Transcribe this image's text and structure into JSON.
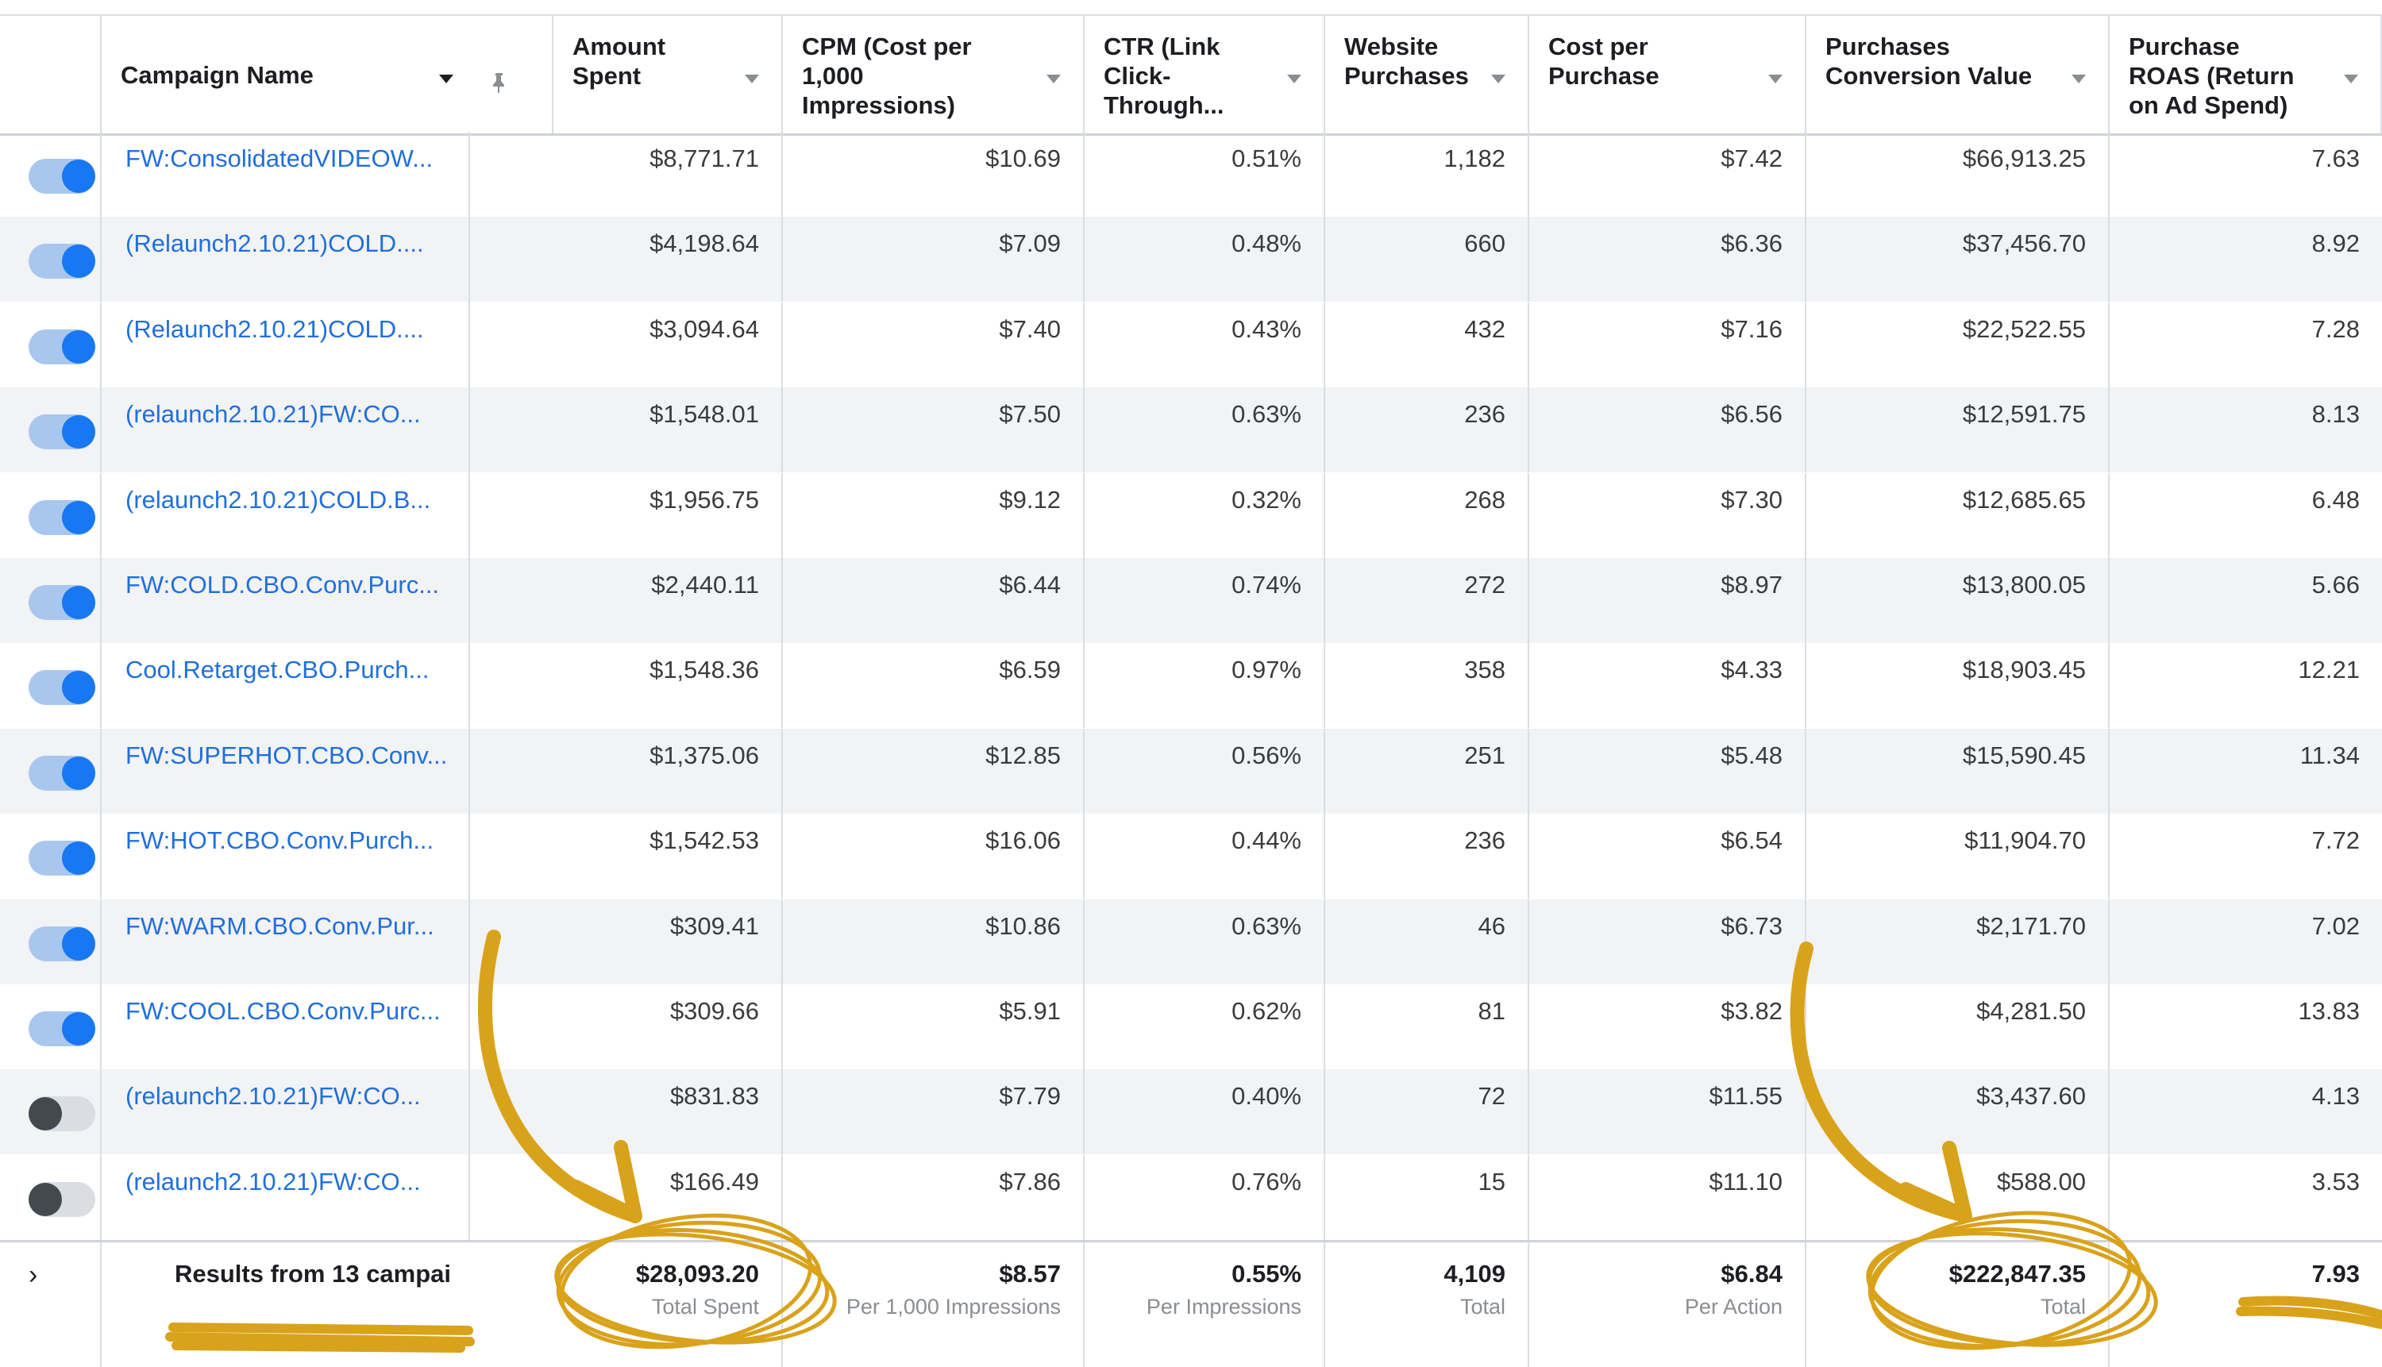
{
  "colors": {
    "accent": "#1877f2",
    "link": "#216fdb",
    "annotation": "#d9a21b"
  },
  "headers": [
    {
      "key": "toggle",
      "label": ""
    },
    {
      "key": "campaign_name",
      "label": "Campaign Name"
    },
    {
      "key": "amount_spent",
      "label": "Amount\nSpent"
    },
    {
      "key": "cpm",
      "label": "CPM (Cost per\n1,000\nImpressions)"
    },
    {
      "key": "ctr",
      "label": "CTR (Link\nClick-\nThrough..."
    },
    {
      "key": "website_purchases",
      "label": "Website\nPurchases"
    },
    {
      "key": "cost_per_purchase",
      "label": "Cost per\nPurchase"
    },
    {
      "key": "conversion_value",
      "label": "Purchases\nConversion Value"
    },
    {
      "key": "roas",
      "label": "Purchase\nROAS (Return\non Ad Spend)"
    }
  ],
  "rows": [
    {
      "on": true,
      "name": "FW:ConsolidatedVIDEOW...",
      "spent": "$8,771.71",
      "cpm": "$10.69",
      "ctr": "0.51%",
      "purchases": "1,182",
      "cpp": "$7.42",
      "value": "$66,913.25",
      "roas": "7.63"
    },
    {
      "on": true,
      "name": "(Relaunch2.10.21)COLD....",
      "spent": "$4,198.64",
      "cpm": "$7.09",
      "ctr": "0.48%",
      "purchases": "660",
      "cpp": "$6.36",
      "value": "$37,456.70",
      "roas": "8.92"
    },
    {
      "on": true,
      "name": "(Relaunch2.10.21)COLD....",
      "spent": "$3,094.64",
      "cpm": "$7.40",
      "ctr": "0.43%",
      "purchases": "432",
      "cpp": "$7.16",
      "value": "$22,522.55",
      "roas": "7.28"
    },
    {
      "on": true,
      "name": "(relaunch2.10.21)FW:CO...",
      "spent": "$1,548.01",
      "cpm": "$7.50",
      "ctr": "0.63%",
      "purchases": "236",
      "cpp": "$6.56",
      "value": "$12,591.75",
      "roas": "8.13"
    },
    {
      "on": true,
      "name": "(relaunch2.10.21)COLD.B...",
      "spent": "$1,956.75",
      "cpm": "$9.12",
      "ctr": "0.32%",
      "purchases": "268",
      "cpp": "$7.30",
      "value": "$12,685.65",
      "roas": "6.48"
    },
    {
      "on": true,
      "name": "FW:COLD.CBO.Conv.Purc...",
      "spent": "$2,440.11",
      "cpm": "$6.44",
      "ctr": "0.74%",
      "purchases": "272",
      "cpp": "$8.97",
      "value": "$13,800.05",
      "roas": "5.66"
    },
    {
      "on": true,
      "name": "Cool.Retarget.CBO.Purch...",
      "spent": "$1,548.36",
      "cpm": "$6.59",
      "ctr": "0.97%",
      "purchases": "358",
      "cpp": "$4.33",
      "value": "$18,903.45",
      "roas": "12.21"
    },
    {
      "on": true,
      "name": "FW:SUPERHOT.CBO.Conv...",
      "spent": "$1,375.06",
      "cpm": "$12.85",
      "ctr": "0.56%",
      "purchases": "251",
      "cpp": "$5.48",
      "value": "$15,590.45",
      "roas": "11.34"
    },
    {
      "on": true,
      "name": "FW:HOT.CBO.Conv.Purch...",
      "spent": "$1,542.53",
      "cpm": "$16.06",
      "ctr": "0.44%",
      "purchases": "236",
      "cpp": "$6.54",
      "value": "$11,904.70",
      "roas": "7.72"
    },
    {
      "on": true,
      "name": "FW:WARM.CBO.Conv.Pur...",
      "spent": "$309.41",
      "cpm": "$10.86",
      "ctr": "0.63%",
      "purchases": "46",
      "cpp": "$6.73",
      "value": "$2,171.70",
      "roas": "7.02"
    },
    {
      "on": true,
      "name": "FW:COOL.CBO.Conv.Purc...",
      "spent": "$309.66",
      "cpm": "$5.91",
      "ctr": "0.62%",
      "purchases": "81",
      "cpp": "$3.82",
      "value": "$4,281.50",
      "roas": "13.83"
    },
    {
      "on": false,
      "name": "(relaunch2.10.21)FW:CO...",
      "spent": "$831.83",
      "cpm": "$7.79",
      "ctr": "0.40%",
      "purchases": "72",
      "cpp": "$11.55",
      "value": "$3,437.60",
      "roas": "4.13"
    },
    {
      "on": false,
      "name": "(relaunch2.10.21)FW:CO...",
      "spent": "$166.49",
      "cpm": "$7.86",
      "ctr": "0.76%",
      "purchases": "15",
      "cpp": "$11.10",
      "value": "$588.00",
      "roas": "3.53"
    }
  ],
  "summary": {
    "results_label": "Results from 13 campai",
    "spent": {
      "value": "$28,093.20",
      "sub": "Total Spent"
    },
    "cpm": {
      "value": "$8.57",
      "sub": "Per 1,000 Impressions"
    },
    "ctr": {
      "value": "0.55%",
      "sub": "Per Impressions"
    },
    "purchases": {
      "value": "4,109",
      "sub": "Total"
    },
    "cpp": {
      "value": "$6.84",
      "sub": "Per Action"
    },
    "value": {
      "value": "$222,847.35",
      "sub": "Total"
    },
    "roas": {
      "value": "7.93",
      "sub": ""
    }
  }
}
